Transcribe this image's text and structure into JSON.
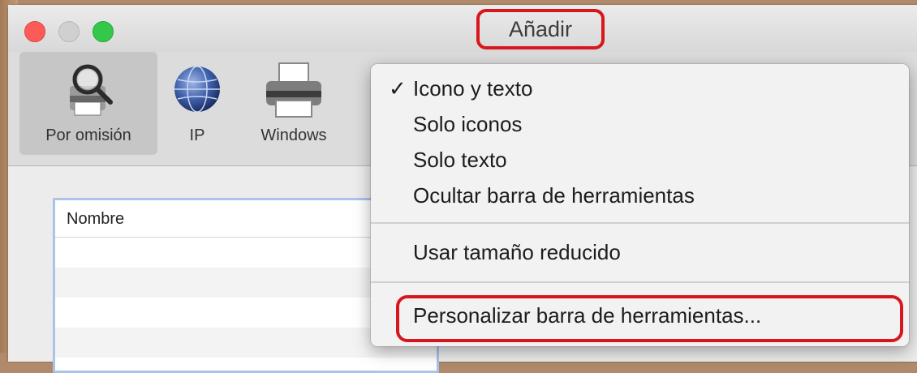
{
  "window": {
    "title": "Añadir"
  },
  "toolbar": {
    "items": [
      {
        "label": "Por omisión",
        "icon": "printer-search-icon",
        "selected": true
      },
      {
        "label": "IP",
        "icon": "globe-icon",
        "selected": false
      },
      {
        "label": "Windows",
        "icon": "printer-icon",
        "selected": false
      }
    ]
  },
  "list": {
    "column_header": "Nombre"
  },
  "context_menu": {
    "checkmark": "✓",
    "items": [
      {
        "label": "Icono y texto",
        "checked": true
      },
      {
        "label": "Solo iconos",
        "checked": false
      },
      {
        "label": "Solo texto",
        "checked": false
      },
      {
        "label": "Ocultar barra de herramientas",
        "checked": false
      },
      {
        "label": "Usar tamaño reducido",
        "checked": false
      },
      {
        "label": "Personalizar barra de herramientas...",
        "checked": false
      }
    ]
  },
  "colors": {
    "highlight": "#d8171d",
    "close": "#fc5b57",
    "maximize": "#34c84a",
    "list_focus": "#a9c4e8"
  }
}
